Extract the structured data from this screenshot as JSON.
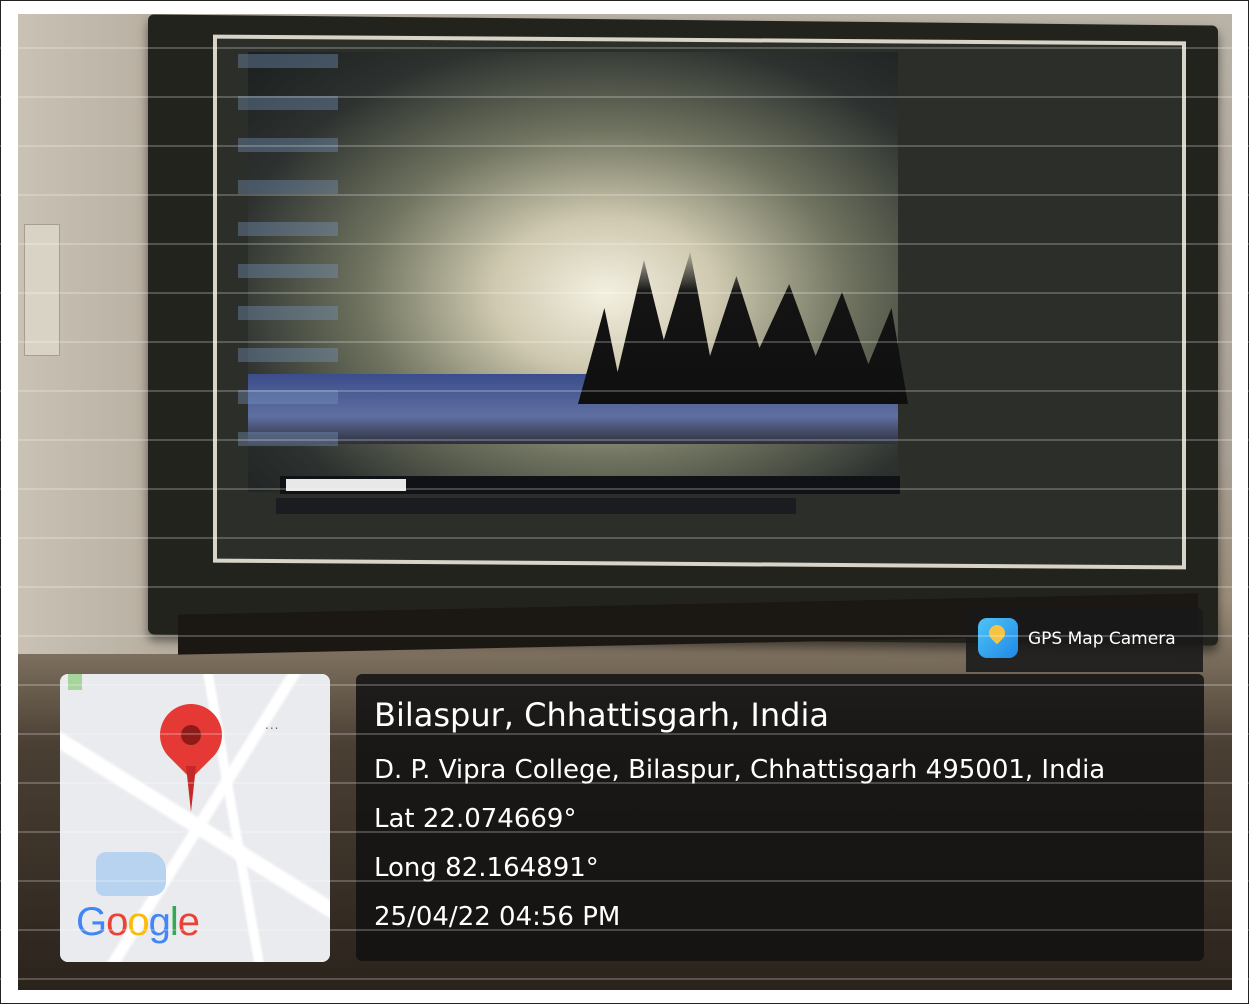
{
  "badge": {
    "label": "GPS Map Camera",
    "icon": "map-pin-app-icon"
  },
  "map": {
    "logo_letters": [
      "G",
      "o",
      "o",
      "g",
      "l",
      "e"
    ],
    "menu_glyph": "...",
    "pin_color": "#e53935"
  },
  "location": {
    "city_line": "Bilaspur, Chhattisgarh, India",
    "address": "D. P. Vipra College, Bilaspur, Chhattisgarh 495001, India",
    "latitude": "Lat 22.074669°",
    "longitude": "Long 82.164891°",
    "datetime": "25/04/22 04:56 PM"
  },
  "colors": {
    "panel_bg": "#121212",
    "text": "#ffffff",
    "google_blue": "#4285f4",
    "google_red": "#ea4335",
    "google_yellow": "#fbbc05",
    "google_green": "#34a853"
  }
}
